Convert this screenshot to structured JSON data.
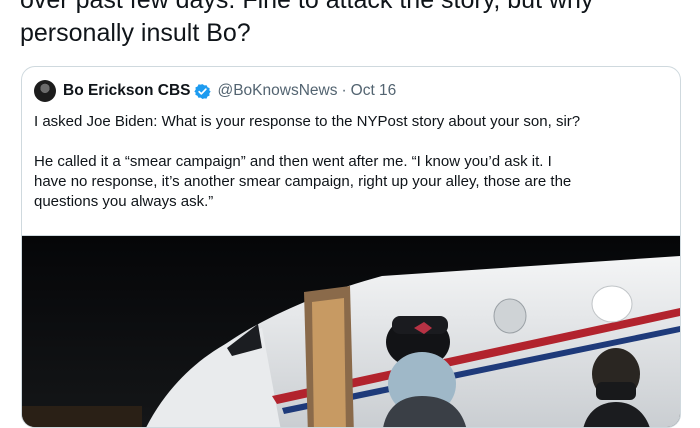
{
  "tweet": {
    "text_lines": [
      "over past few days. Fine to attack the story, but why",
      "personally insult Bo?"
    ]
  },
  "quoted_tweet": {
    "author_name": "Bo Erickson CBS",
    "handle": "@BoKnowsNews",
    "separator": "·",
    "date": "Oct 16",
    "paragraph_1": "I asked Joe Biden: What is your response to the NYPost story about your son, sir?",
    "paragraph_2_lines": [
      "He called it a “smear campaign” and then went after me. “I know you’d ask it. I",
      "have no response, it’s another smear campaign, right up your alley, those are the",
      "questions you always ask.”"
    ],
    "media_icon": "photo-of-man-at-airplane-stairs"
  },
  "colors": {
    "text": "#0f1419",
    "secondary_text": "#536471",
    "verified_badge": "#1d9bf0",
    "border": "#cfd9de"
  }
}
